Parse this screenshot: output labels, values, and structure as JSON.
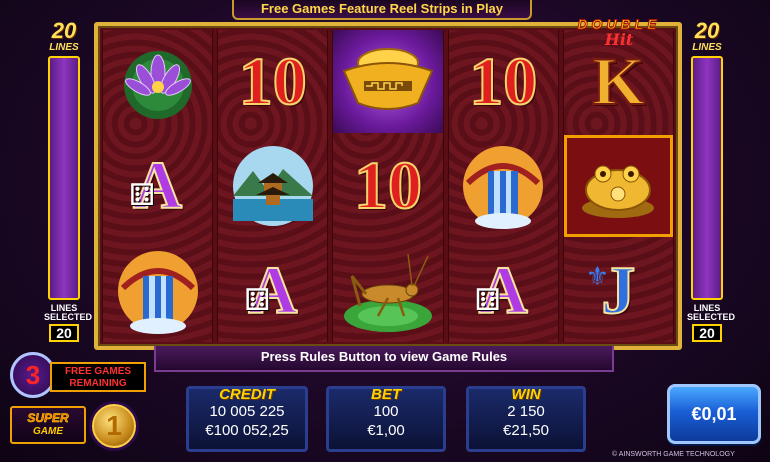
{
  "header": {
    "banner": "Free Games Feature Reel Strips in Play"
  },
  "logo": {
    "top": "DOUBLE",
    "bottom": "Hit"
  },
  "lines": {
    "left_count": "20",
    "right_count": "20",
    "label": "LINES",
    "selected_label_1": "LINES",
    "selected_label_2": "SELECTED",
    "left_selected": "20",
    "right_selected": "20"
  },
  "reels": [
    [
      "lotus",
      "A",
      "waterfall"
    ],
    [
      "10",
      "pagoda",
      "A"
    ],
    [
      "gold-ingot",
      "10",
      "grasshopper"
    ],
    [
      "10",
      "waterfall",
      "A"
    ],
    [
      "K",
      "golden-frog",
      "J"
    ]
  ],
  "rules_message": "Press Rules Button to view Game Rules",
  "free_games": {
    "count": "3",
    "label_1": "FREE GAMES",
    "label_2": "REMAINING"
  },
  "super_game": {
    "line1": "SUPER",
    "line2": "GAME",
    "count": "1"
  },
  "meters": {
    "credit": {
      "label": "CREDIT",
      "credits": "10 005 225",
      "amount": "€100 052,25"
    },
    "bet": {
      "label": "BET",
      "credits": "100",
      "amount": "€1,00"
    },
    "win": {
      "label": "WIN",
      "credits": "2 150",
      "amount": "€21,50"
    }
  },
  "denomination": "€0,01",
  "copyright": "© AINSWORTH GAME TECHNOLOGY",
  "colors": {
    "accent_gold": "#ffd200",
    "panel_purple": "#8e35c0",
    "denom_blue": "#1a5fd6"
  }
}
